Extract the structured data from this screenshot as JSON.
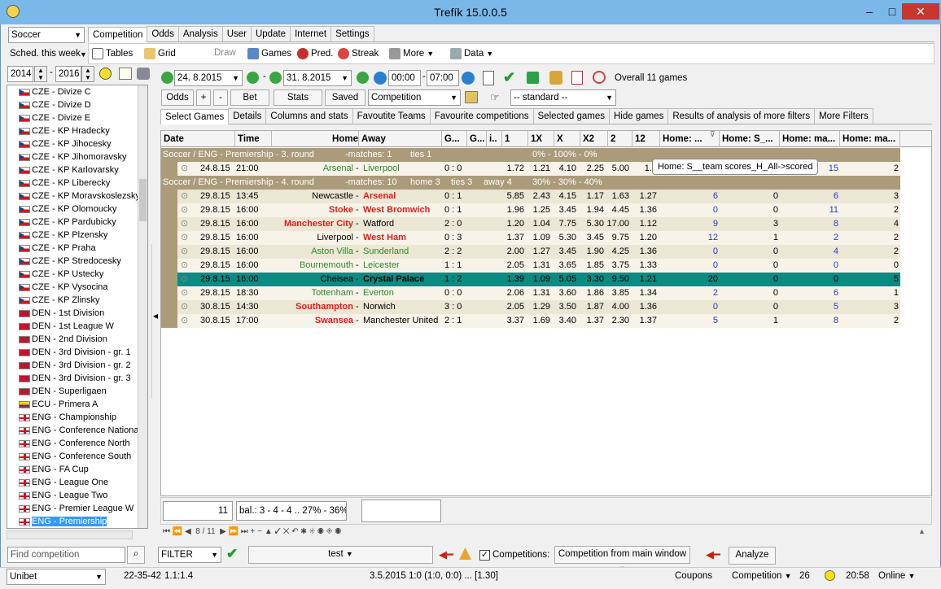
{
  "app": {
    "title": "Trefík 15.0.0.5"
  },
  "left": {
    "sport": "Soccer",
    "sched": "Sched. this week",
    "year_from": "2014",
    "year_to": "2016",
    "find_placeholder": "Find competition",
    "competitions": [
      {
        "name": "CZE - Divize C",
        "flag": "cze"
      },
      {
        "name": "CZE - Divize D",
        "flag": "cze"
      },
      {
        "name": "CZE - Divize E",
        "flag": "cze"
      },
      {
        "name": "CZE - KP Hradecky",
        "flag": "cze"
      },
      {
        "name": "CZE - KP Jihocesky",
        "flag": "cze"
      },
      {
        "name": "CZE - KP Jihomoravsky",
        "flag": "cze"
      },
      {
        "name": "CZE - KP Karlovarsky",
        "flag": "cze"
      },
      {
        "name": "CZE - KP Liberecky",
        "flag": "cze"
      },
      {
        "name": "CZE - KP Moravskoslezsky",
        "flag": "cze"
      },
      {
        "name": "CZE - KP Olomoucky",
        "flag": "cze"
      },
      {
        "name": "CZE - KP Pardubicky",
        "flag": "cze"
      },
      {
        "name": "CZE - KP Plzensky",
        "flag": "cze"
      },
      {
        "name": "CZE - KP Praha",
        "flag": "cze"
      },
      {
        "name": "CZE - KP Stredocesky",
        "flag": "cze"
      },
      {
        "name": "CZE - KP Ustecky",
        "flag": "cze"
      },
      {
        "name": "CZE - KP Vysocina",
        "flag": "cze"
      },
      {
        "name": "CZE - KP Zlinsky",
        "flag": "cze"
      },
      {
        "name": "DEN - 1st Division",
        "flag": "den"
      },
      {
        "name": "DEN - 1st League W",
        "flag": "den"
      },
      {
        "name": "DEN - 2nd Division",
        "flag": "den"
      },
      {
        "name": "DEN - 3rd Division - gr. 1",
        "flag": "den"
      },
      {
        "name": "DEN - 3rd Division - gr. 2",
        "flag": "den"
      },
      {
        "name": "DEN - 3rd Division - gr. 3",
        "flag": "den"
      },
      {
        "name": "DEN - Superligaen",
        "flag": "den"
      },
      {
        "name": "ECU - Primera A",
        "flag": "ecu"
      },
      {
        "name": "ENG - Championship",
        "flag": "eng"
      },
      {
        "name": "ENG - Conference Nationa",
        "flag": "eng"
      },
      {
        "name": "ENG - Conference North",
        "flag": "eng"
      },
      {
        "name": "ENG - Conference South",
        "flag": "eng"
      },
      {
        "name": "ENG - FA Cup",
        "flag": "eng"
      },
      {
        "name": "ENG - League One",
        "flag": "eng"
      },
      {
        "name": "ENG - League Two",
        "flag": "eng"
      },
      {
        "name": "ENG - Premier League W",
        "flag": "eng"
      },
      {
        "name": "ENG - Premiership",
        "flag": "eng",
        "selected": true
      }
    ]
  },
  "menu_tabs": [
    "Competition",
    "Odds",
    "Analysis",
    "User",
    "Update",
    "Internet",
    "Settings"
  ],
  "toolbar": {
    "tables": "Tables",
    "grid": "Grid",
    "draw": "Draw",
    "games": "Games",
    "pred": "Pred.",
    "streak": "Streak",
    "more": "More",
    "data": "Data"
  },
  "dates": {
    "from": "24. 8.2015",
    "to": "31. 8.2015",
    "time_from": "00:00",
    "time_to": "07:00",
    "overall": "Overall 11 games"
  },
  "buttons": {
    "odds": "Odds",
    "plus": "+",
    "minus": "-",
    "bet": "Bet",
    "stats": "Stats",
    "saved": "Saved",
    "competition": "Competition",
    "standard": "-- standard --"
  },
  "subtabs": [
    "Select Games",
    "Details",
    "Columns and stats",
    "Favoutite Teams",
    "Favourite competitions",
    "Selected games",
    "Hide games",
    "Results of analysis of more filters",
    "More Filters"
  ],
  "columns": [
    "Date",
    "Time",
    "Home",
    "Away",
    "G...",
    "G...",
    "i..",
    "1",
    "1X",
    "X",
    "X2",
    "2",
    "12",
    "Home: ...",
    "Home: S_...",
    "Home: ma...",
    "Home: ma..."
  ],
  "tooltip": "Home: S__team scores_H_All->scored",
  "groups": [
    {
      "title": "Soccer / ENG - Premiership - 3. round",
      "m": "-matches: 1",
      "t": "ties 1",
      "p": "0% - 100% - 0%"
    },
    {
      "title": "Soccer / ENG - Premiership - 4. round",
      "m": "-matches: 10",
      "t": "home 3",
      "t2": "ties 3",
      "t3": "away 4",
      "p": "30% - 30% - 40%"
    }
  ],
  "matches": [
    {
      "date": "24.8.15",
      "time": "21:00",
      "home": "Arsenal",
      "away": "Liverpool",
      "score": "0 : 0",
      "o1": "1.72",
      "o1x": "1.21",
      "ox": "4.10",
      "ox2": "2.25",
      "o2": "5.00",
      "o12": "1.2",
      "h1": "",
      "h2": "",
      "h3": "15",
      "h4": "2"
    },
    {
      "date": "29.8.15",
      "time": "13:45",
      "home": "Newcastle",
      "away": "Arsenal",
      "score": "0 : 1",
      "o1": "5.85",
      "o1x": "2.43",
      "ox": "4.15",
      "ox2": "1.17",
      "o2": "1.63",
      "o12": "1.27",
      "h1": "6",
      "h2": "0",
      "h3": "6",
      "h4": "3"
    },
    {
      "date": "29.8.15",
      "time": "16:00",
      "home": "Stoke",
      "away": "West Bromwich",
      "score": "0 : 1",
      "o1": "1.96",
      "o1x": "1.25",
      "ox": "3.45",
      "ox2": "1.94",
      "o2": "4.45",
      "o12": "1.36",
      "h1": "0",
      "h2": "0",
      "h3": "11",
      "h4": "2"
    },
    {
      "date": "29.8.15",
      "time": "16:00",
      "home": "Manchester City",
      "away": "Watford",
      "score": "2 : 0",
      "o1": "1.20",
      "o1x": "1.04",
      "ox": "7.75",
      "ox2": "5.30",
      "o2": "17.00",
      "o12": "1.12",
      "h1": "9",
      "h2": "3",
      "h3": "8",
      "h4": "4"
    },
    {
      "date": "29.8.15",
      "time": "16:00",
      "home": "Liverpool",
      "away": "West Ham",
      "score": "0 : 3",
      "o1": "1.37",
      "o1x": "1.09",
      "ox": "5.30",
      "ox2": "3.45",
      "o2": "9.75",
      "o12": "1.20",
      "h1": "12",
      "h2": "1",
      "h3": "2",
      "h4": "2"
    },
    {
      "date": "29.8.15",
      "time": "16:00",
      "home": "Aston Villa",
      "away": "Sunderland",
      "score": "2 : 2",
      "o1": "2.00",
      "o1x": "1.27",
      "ox": "3.45",
      "ox2": "1.90",
      "o2": "4.25",
      "o12": "1.36",
      "h1": "0",
      "h2": "0",
      "h3": "4",
      "h4": "2"
    },
    {
      "date": "29.8.15",
      "time": "16:00",
      "home": "Bournemouth",
      "away": "Leicester",
      "score": "1 : 1",
      "o1": "2.05",
      "o1x": "1.31",
      "ox": "3.65",
      "ox2": "1.85",
      "o2": "3.75",
      "o12": "1.33",
      "h1": "0",
      "h2": "0",
      "h3": "0",
      "h4": "0"
    },
    {
      "date": "29.8.15",
      "time": "16:00",
      "home": "Chelsea",
      "away": "Crystal Palace",
      "score": "1 : 2",
      "o1": "1.39",
      "o1x": "1.09",
      "ox": "5.05",
      "ox2": "3.30",
      "o2": "9.50",
      "o12": "1.21",
      "h1": "20",
      "h2": "0",
      "h3": "0",
      "h4": "5"
    },
    {
      "date": "29.8.15",
      "time": "18:30",
      "home": "Tottenham",
      "away": "Everton",
      "score": "0 : 0",
      "o1": "2.06",
      "o1x": "1.31",
      "ox": "3.60",
      "ox2": "1.86",
      "o2": "3.85",
      "o12": "1.34",
      "h1": "2",
      "h2": "0",
      "h3": "6",
      "h4": "1"
    },
    {
      "date": "30.8.15",
      "time": "14:30",
      "home": "Southampton",
      "away": "Norwich",
      "score": "3 : 0",
      "o1": "2.05",
      "o1x": "1.29",
      "ox": "3.50",
      "ox2": "1.87",
      "o2": "4.00",
      "o12": "1.36",
      "h1": "0",
      "h2": "0",
      "h3": "5",
      "h4": "3"
    },
    {
      "date": "30.8.15",
      "time": "17:00",
      "home": "Swansea",
      "away": "Manchester United",
      "score": "2 : 1",
      "o1": "3.37",
      "o1x": "1.69",
      "ox": "3.40",
      "ox2": "1.37",
      "o2": "2.30",
      "o12": "1.37",
      "h1": "5",
      "h2": "1",
      "h3": "8",
      "h4": "2"
    }
  ],
  "footer": {
    "count": "11",
    "bal": "bal.: 3 - 4 - 4 .. 27% - 36% -",
    "nav": "8 / 11"
  },
  "filterbar": {
    "filter": "FILTER",
    "test": "test",
    "competitions": "Competitions:",
    "from_main": "Competition from main window",
    "analyze": "Analyze"
  },
  "status": {
    "bookie": "Unibet",
    "code": "22-35-42",
    "ratio": "1.1:1.4",
    "match": "3.5.2015 1:0 (1:0, 0:0) ... [1.30]",
    "coupons": "Coupons",
    "competition": "Competition",
    "count": "26",
    "time": "20:58",
    "online": "Online"
  }
}
